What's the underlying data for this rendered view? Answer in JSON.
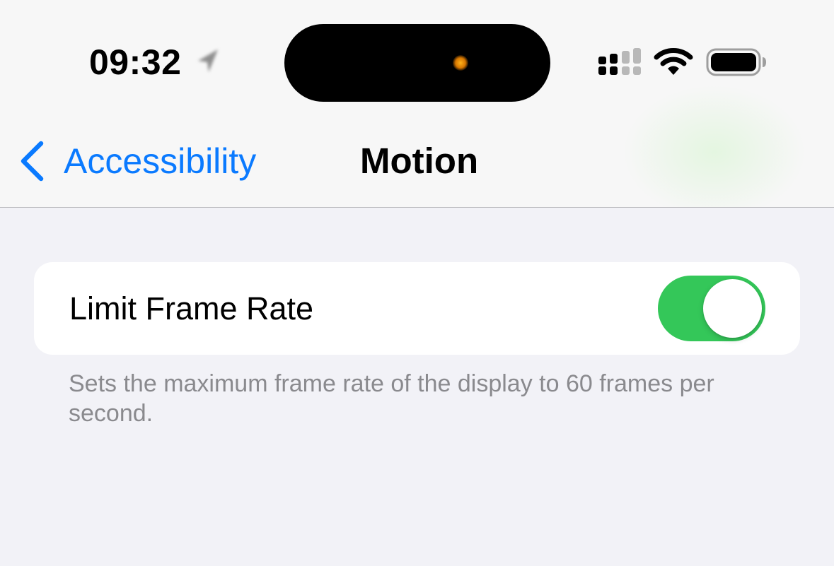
{
  "status_bar": {
    "time": "09:32",
    "icons": [
      "location-arrow-icon",
      "cellular-signal-icon",
      "wifi-icon",
      "battery-icon"
    ]
  },
  "nav": {
    "back_label": "Accessibility",
    "title": "Motion"
  },
  "settings": [
    {
      "label": "Limit Frame Rate",
      "enabled": true
    }
  ],
  "footer": "Sets the maximum frame rate of the display to 60 frames per second.",
  "colors": {
    "accent": "#0a7aff",
    "toggle_on": "#34c759",
    "page_background": "#f2f2f7",
    "footer_text": "#8a8a8e"
  }
}
